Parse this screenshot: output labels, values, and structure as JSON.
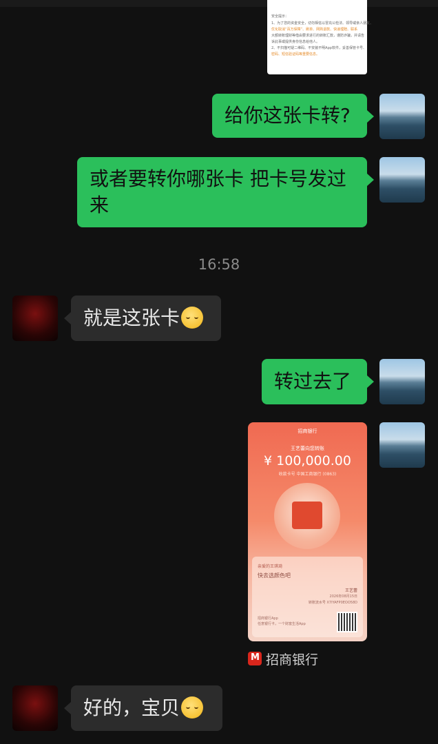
{
  "document_snippet": {
    "title": "安全提示：",
    "lines": [
      "1、为了您的资金安全，切勿相信以冒充公检法、领导或亲人朋友、",
      "优化取消“百万保障”、刷单、网购退款、快递理赔、联系",
      "大额转账理财等借由要求进行的转账汇款，谨防诈骗，并请告",
      "诉此事或提供身份信息给他人。",
      "2、不扫描可疑二维码、不安装不明App软件，妥善保管卡号、",
      "密码、短信验证码等重要信息。"
    ]
  },
  "messages": [
    {
      "side": "me",
      "text": "给你这张卡转?"
    },
    {
      "side": "me",
      "text": "或者要转你哪张卡 把卡号发过来"
    },
    {
      "side": "time",
      "text": "16:58"
    },
    {
      "side": "other",
      "text": "就是这张卡",
      "emoji": "sleepy-smile"
    },
    {
      "side": "me",
      "text": "转过去了"
    },
    {
      "side": "me",
      "type": "transfer_card"
    },
    {
      "side": "other",
      "text": "好的，宝贝",
      "emoji": "sleepy-smile"
    }
  ],
  "transfer_card": {
    "bank_name": "招商银行",
    "line1": "王艺蕾向您转账",
    "amount": "¥ 100,000.00",
    "sub": "收款卡号  中国工商银行 (0863)",
    "dear": "亲爱的王琪琦",
    "pick": "快去选颜色吧",
    "signature": "王艺蕾",
    "date": "2026年08月15日",
    "serial": "转账流水号 X7IYAFP0EOO58D",
    "app": "招商银行App",
    "slogan": "任意银行卡，一个财富生活App",
    "source_label": "招商银行"
  },
  "colors": {
    "background": "#111111",
    "my_bubble": "#2bbf5b",
    "other_bubble": "#2c2c2c",
    "card_top": "#f06a52"
  }
}
